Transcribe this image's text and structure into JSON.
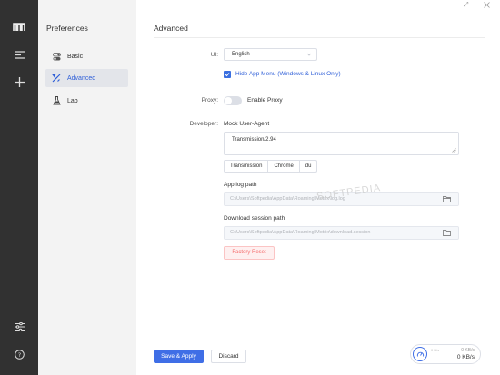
{
  "sidebar": {
    "icons": [
      "logo-icon",
      "menu-list-icon",
      "add-icon",
      "settings-sliders-icon",
      "help-icon"
    ]
  },
  "subnav": {
    "title": "Preferences",
    "items": [
      {
        "label": "Basic",
        "icon": "toggle-icon"
      },
      {
        "label": "Advanced",
        "icon": "tools-icon",
        "active": true
      },
      {
        "label": "Lab",
        "icon": "flask-icon"
      }
    ]
  },
  "window": {
    "minimize": "—",
    "maximize": "⤢"
  },
  "page": {
    "title": "Advanced",
    "ui": {
      "label": "UI:",
      "language": "English",
      "hide_menu": "Hide App Menu (Windows & Linux Only)",
      "hide_menu_checked": true
    },
    "proxy": {
      "label": "Proxy:",
      "toggle_label": "Enable Proxy",
      "enabled": false
    },
    "developer": {
      "label": "Developer:",
      "ua_label": "Mock User-Agent",
      "ua_value": "Transmission/2.94",
      "ua_buttons": [
        "Transmission",
        "Chrome",
        "du"
      ],
      "log_label": "App log path",
      "log_path": "C:\\Users\\Softpedia\\AppData\\Roaming\\Motrix\\log.log",
      "session_label": "Download session path",
      "session_path": "C:\\Users\\Softpedia\\AppData\\Roaming\\Motrix\\download.session",
      "reset_label": "Factory Reset"
    },
    "watermark": "SOFTPEDIA"
  },
  "footer": {
    "save_label": "Save & Apply",
    "discard_label": "Discard"
  },
  "speed": {
    "mini_label": "0 B/s",
    "upload": "0 KB/s",
    "download": "0 KB/s"
  },
  "colors": {
    "accent": "#3f6ee6",
    "sidebar": "#313131",
    "danger": "#f56c6c"
  }
}
